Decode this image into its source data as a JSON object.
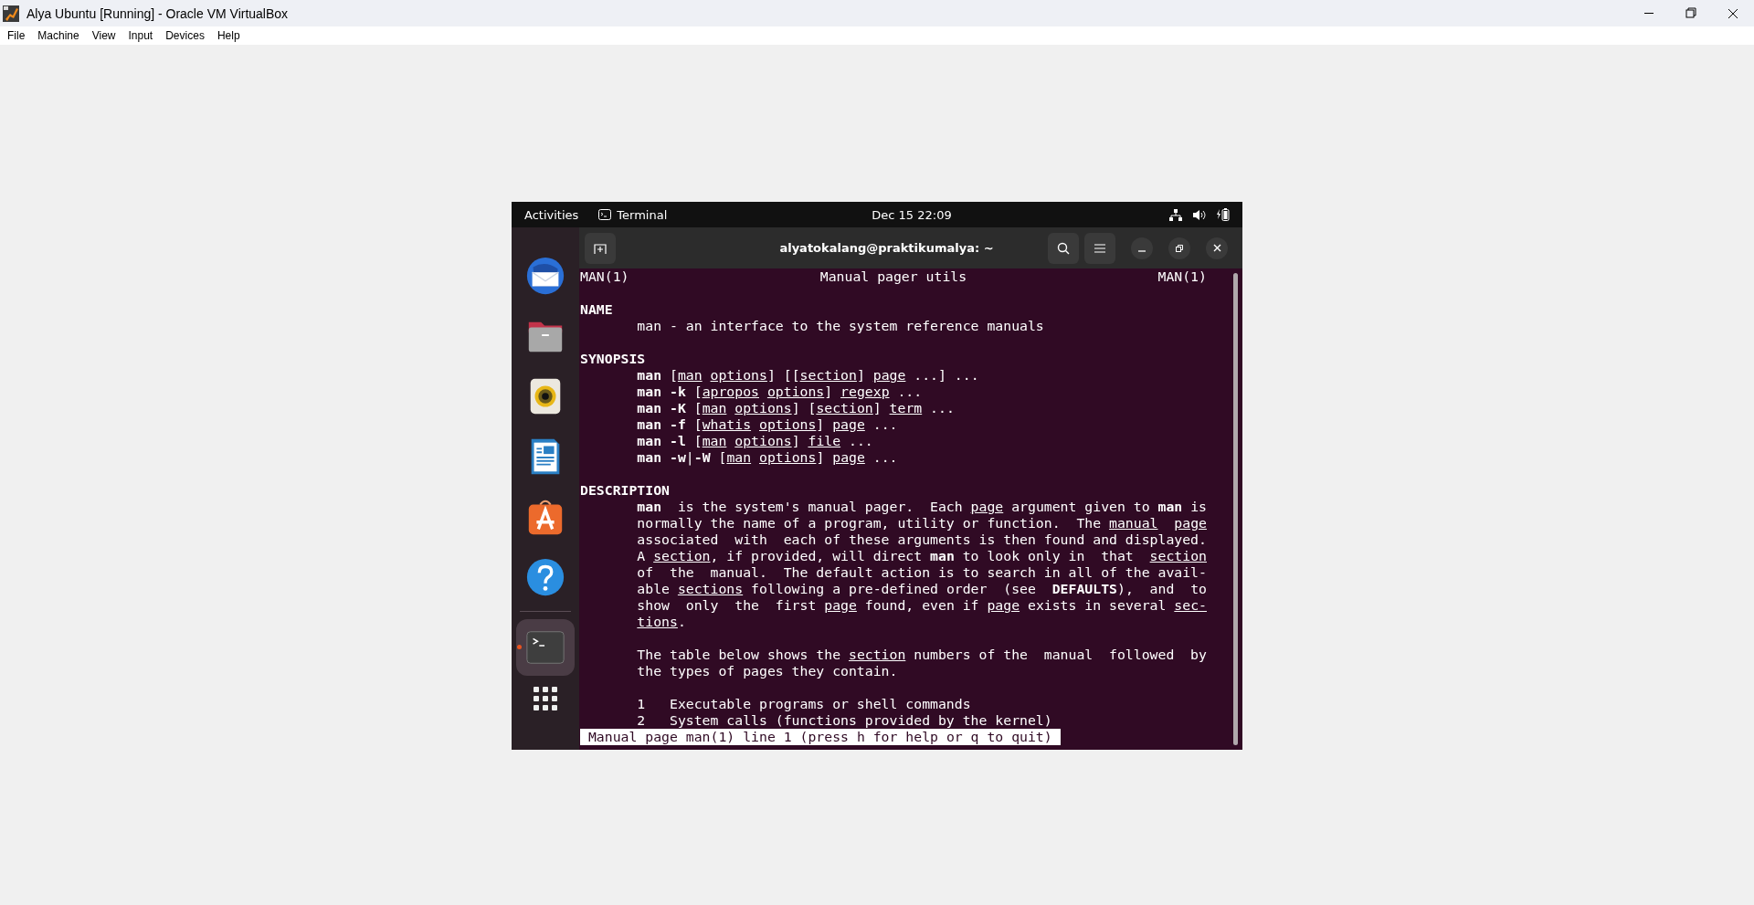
{
  "host_window": {
    "title": "Alya Ubuntu [Running] - Oracle VM VirtualBox",
    "menu": [
      "File",
      "Machine",
      "View",
      "Input",
      "Devices",
      "Help"
    ]
  },
  "guest": {
    "top_bar": {
      "activities": "Activities",
      "app": "Terminal",
      "clock": "Dec 15  22:09"
    },
    "dock": {
      "favorites": [
        {
          "kind": "mail",
          "active": false,
          "running": false
        },
        {
          "kind": "folder",
          "active": false,
          "running": false
        },
        {
          "kind": "speaker",
          "active": false,
          "running": false
        },
        {
          "kind": "document",
          "active": false,
          "running": false
        },
        {
          "kind": "store",
          "active": false,
          "running": false
        },
        {
          "kind": "help",
          "active": false,
          "running": false
        }
      ],
      "running_apps": [
        {
          "kind": "terminal",
          "active": true,
          "running": true
        }
      ]
    },
    "terminal": {
      "title": "alyatokalang@praktikumalya: ~",
      "page_header": {
        "left": "MAN(1)",
        "center": "Manual pager utils",
        "right": "MAN(1)"
      },
      "lines": [
        {
          "kind": "blank"
        },
        {
          "kind": "heading",
          "text": "NAME"
        },
        {
          "kind": "text",
          "segments": [
            {
              "text": "man - an interface to the system reference manuals",
              "kind": "plain"
            }
          ]
        },
        {
          "kind": "blank"
        },
        {
          "kind": "heading",
          "text": "SYNOPSIS"
        },
        {
          "kind": "text",
          "segments": [
            {
              "text": "man",
              "kind": "bold"
            },
            {
              "text": " [",
              "kind": "plain"
            },
            {
              "text": "man options",
              "kind": "underline"
            },
            {
              "text": "] [[",
              "kind": "plain"
            },
            {
              "text": "section",
              "kind": "underline"
            },
            {
              "text": "] ",
              "kind": "plain"
            },
            {
              "text": "page",
              "kind": "underline"
            },
            {
              "text": " ...] ...",
              "kind": "plain"
            }
          ]
        },
        {
          "kind": "text",
          "segments": [
            {
              "text": "man -k",
              "kind": "bold"
            },
            {
              "text": " [",
              "kind": "plain"
            },
            {
              "text": "apropos options",
              "kind": "underline"
            },
            {
              "text": "] ",
              "kind": "plain"
            },
            {
              "text": "regexp",
              "kind": "underline"
            },
            {
              "text": " ...",
              "kind": "plain"
            }
          ]
        },
        {
          "kind": "text",
          "segments": [
            {
              "text": "man -K",
              "kind": "bold"
            },
            {
              "text": " [",
              "kind": "plain"
            },
            {
              "text": "man options",
              "kind": "underline"
            },
            {
              "text": "] [",
              "kind": "plain"
            },
            {
              "text": "section",
              "kind": "underline"
            },
            {
              "text": "] ",
              "kind": "plain"
            },
            {
              "text": "term",
              "kind": "underline"
            },
            {
              "text": " ...",
              "kind": "plain"
            }
          ]
        },
        {
          "kind": "text",
          "segments": [
            {
              "text": "man -f",
              "kind": "bold"
            },
            {
              "text": " [",
              "kind": "plain"
            },
            {
              "text": "whatis options",
              "kind": "underline"
            },
            {
              "text": "] ",
              "kind": "plain"
            },
            {
              "text": "page",
              "kind": "underline"
            },
            {
              "text": " ...",
              "kind": "plain"
            }
          ]
        },
        {
          "kind": "text",
          "segments": [
            {
              "text": "man -l",
              "kind": "bold"
            },
            {
              "text": " [",
              "kind": "plain"
            },
            {
              "text": "man options",
              "kind": "underline"
            },
            {
              "text": "] ",
              "kind": "plain"
            },
            {
              "text": "file",
              "kind": "underline"
            },
            {
              "text": " ...",
              "kind": "plain"
            }
          ]
        },
        {
          "kind": "text",
          "segments": [
            {
              "text": "man -w",
              "kind": "bold"
            },
            {
              "text": "|",
              "kind": "plain"
            },
            {
              "text": "-W",
              "kind": "bold"
            },
            {
              "text": " [",
              "kind": "plain"
            },
            {
              "text": "man options",
              "kind": "underline"
            },
            {
              "text": "] ",
              "kind": "plain"
            },
            {
              "text": "page",
              "kind": "underline"
            },
            {
              "text": " ...",
              "kind": "plain"
            }
          ]
        },
        {
          "kind": "blank"
        },
        {
          "kind": "heading",
          "text": "DESCRIPTION"
        },
        {
          "kind": "text",
          "segments": [
            {
              "text": "man",
              "kind": "bold"
            },
            {
              "text": "  is the system's manual pager.  Each ",
              "kind": "plain"
            },
            {
              "text": "page",
              "kind": "underline"
            },
            {
              "text": " argument given to ",
              "kind": "plain"
            },
            {
              "text": "man",
              "kind": "bold"
            },
            {
              "text": " is",
              "kind": "plain"
            }
          ]
        },
        {
          "kind": "text",
          "segments": [
            {
              "text": "normally the name of a program, utility or function.  The ",
              "kind": "plain"
            },
            {
              "text": "manual  page",
              "kind": "underline"
            }
          ]
        },
        {
          "kind": "text",
          "segments": [
            {
              "text": "associated  with  each of these arguments is then found and displayed.",
              "kind": "plain"
            }
          ]
        },
        {
          "kind": "text",
          "segments": [
            {
              "text": "A ",
              "kind": "plain"
            },
            {
              "text": "section",
              "kind": "underline"
            },
            {
              "text": ", if provided, will direct ",
              "kind": "plain"
            },
            {
              "text": "man",
              "kind": "bold"
            },
            {
              "text": " to look only in  that  ",
              "kind": "plain"
            },
            {
              "text": "section",
              "kind": "underline"
            }
          ]
        },
        {
          "kind": "text",
          "segments": [
            {
              "text": "of  the  manual.  The default action is to search in all of the avail-",
              "kind": "plain"
            }
          ]
        },
        {
          "kind": "text",
          "segments": [
            {
              "text": "able ",
              "kind": "plain"
            },
            {
              "text": "sections",
              "kind": "underline"
            },
            {
              "text": " following a pre-defined order  (see  ",
              "kind": "plain"
            },
            {
              "text": "DEFAULTS",
              "kind": "bold"
            },
            {
              "text": "),  and  to",
              "kind": "plain"
            }
          ]
        },
        {
          "kind": "text",
          "segments": [
            {
              "text": "show  only  the  first ",
              "kind": "plain"
            },
            {
              "text": "page",
              "kind": "underline"
            },
            {
              "text": " found, even if ",
              "kind": "plain"
            },
            {
              "text": "page",
              "kind": "underline"
            },
            {
              "text": " exists in several ",
              "kind": "plain"
            },
            {
              "text": "sec-",
              "kind": "underline"
            }
          ]
        },
        {
          "kind": "text",
          "segments": [
            {
              "text": "tions",
              "kind": "underline"
            },
            {
              "text": ".",
              "kind": "plain"
            }
          ]
        },
        {
          "kind": "blank"
        },
        {
          "kind": "text",
          "segments": [
            {
              "text": "The table below shows the ",
              "kind": "plain"
            },
            {
              "text": "section",
              "kind": "underline"
            },
            {
              "text": " numbers of the  manual  followed  by",
              "kind": "plain"
            }
          ]
        },
        {
          "kind": "text",
          "segments": [
            {
              "text": "the types of pages they contain.",
              "kind": "plain"
            }
          ]
        },
        {
          "kind": "blank"
        },
        {
          "kind": "text",
          "segments": [
            {
              "text": "1   Executable programs or shell commands",
              "kind": "plain"
            }
          ]
        },
        {
          "kind": "text",
          "segments": [
            {
              "text": "2   System calls (functions provided by the kernel)",
              "kind": "plain"
            }
          ]
        }
      ],
      "status": "Manual page man(1) line 1 (press h for help or q to quit)"
    }
  }
}
